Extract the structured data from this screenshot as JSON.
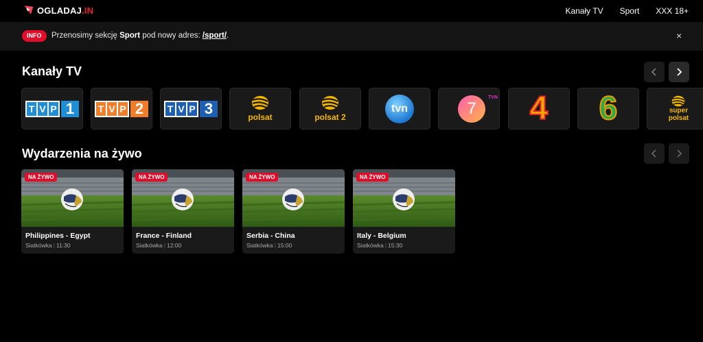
{
  "header": {
    "logo_text": "OGLADAJ",
    "logo_suffix": ".IN",
    "nav": [
      "Kanały TV",
      "Sport",
      "XXX 18+"
    ]
  },
  "info": {
    "badge": "INFO",
    "text_before": "Przenosimy sekcję ",
    "text_bold": "Sport",
    "text_middle": " pod nowy adres: ",
    "link": "/sport/",
    "text_after": ".",
    "close": "×"
  },
  "channels_section": {
    "title": "Kanały TV",
    "channels": [
      {
        "name": "TVP 1",
        "num": "1",
        "color": "#1e8ed6"
      },
      {
        "name": "TVP 2",
        "num": "2",
        "color": "#ef7d2a"
      },
      {
        "name": "TVP 3",
        "num": "3",
        "color": "#1c5fb5"
      },
      {
        "name": "polsat",
        "label": "polsat"
      },
      {
        "name": "polsat 2",
        "label": "polsat",
        "label_num": "2"
      },
      {
        "name": "tvn",
        "label": "tvn"
      },
      {
        "name": "TVN 7",
        "label": "7",
        "label_small": "TVN"
      },
      {
        "name": "TV4",
        "label": "4"
      },
      {
        "name": "TV6",
        "label": "6"
      },
      {
        "name": "super polsat",
        "label": "super",
        "label2": "polsat"
      }
    ]
  },
  "events_section": {
    "title": "Wydarzenia na żywo",
    "live_label": "NA ŻYWO",
    "events": [
      {
        "title": "Philippines - Egypt",
        "sport": "Siatkówka",
        "time": "11:30"
      },
      {
        "title": "France - Finland",
        "sport": "Siatkówka",
        "time": "12:00"
      },
      {
        "title": "Serbia - China",
        "sport": "Siatkówka",
        "time": "15:00"
      },
      {
        "title": "Italy - Belgium",
        "sport": "Siatkówka",
        "time": "15:30"
      }
    ]
  },
  "colors": {
    "accent": "#e00e2a",
    "background": "#000000",
    "card": "#1a1a1a"
  }
}
